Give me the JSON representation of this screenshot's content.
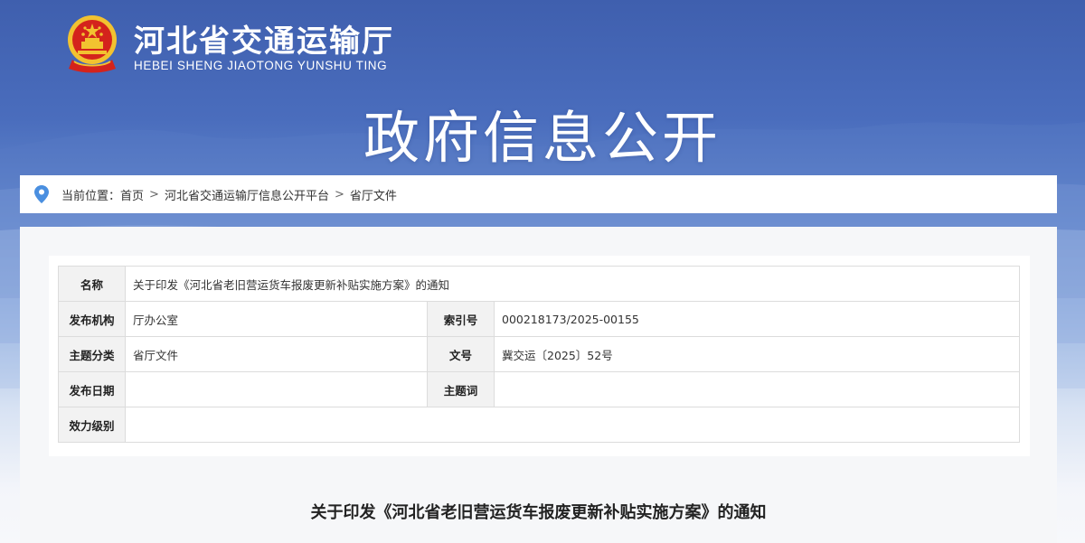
{
  "header": {
    "site_title": "河北省交通运输厅",
    "site_subtitle": "HEBEI SHENG JIAOTONG YUNSHU TING",
    "banner_title": "政府信息公开"
  },
  "breadcrumb": {
    "prefix": "当前位置：",
    "items": [
      "首页",
      "河北省交通运输厅信息公开平台",
      "省厅文件"
    ],
    "separator": ">"
  },
  "info_table": {
    "name_label": "名称",
    "name_value": "关于印发《河北省老旧营运货车报废更新补贴实施方案》的通知",
    "publisher_label": "发布机构",
    "publisher_value": "厅办公室",
    "index_label": "索引号",
    "index_value": "000218173/2025-00155",
    "topic_label": "主题分类",
    "topic_value": "省厅文件",
    "doc_no_label": "文号",
    "doc_no_value": "冀交运〔2025〕52号",
    "date_label": "发布日期",
    "date_value": "",
    "keywords_label": "主题词",
    "keywords_value": "",
    "validity_label": "效力级别",
    "validity_value": ""
  },
  "document": {
    "heading": "关于印发《河北省老旧营运货车报废更新补贴实施方案》的通知"
  },
  "colors": {
    "banner_top": "#3f5fae",
    "banner_bottom": "#f7f8fb",
    "emblem_red": "#d4231c",
    "emblem_gold": "#f2c230",
    "pin_blue": "#4a8fe0"
  },
  "icons": {
    "emblem": "national-emblem",
    "location": "location-pin-icon"
  }
}
